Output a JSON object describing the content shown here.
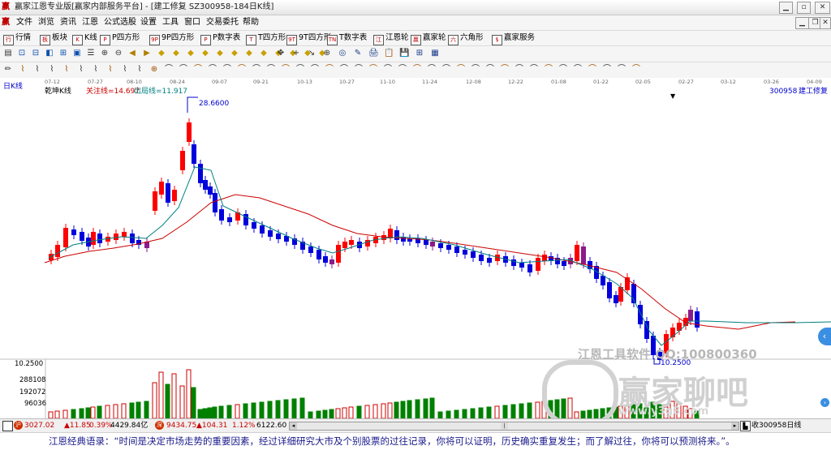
{
  "window": {
    "app_logo": "赢",
    "title": "赢家江恩专业版[赢家内部服务平台] - [建工修复 SZ300958-184日K线]"
  },
  "menu": {
    "logo": "赢",
    "items": [
      "文件",
      "浏览",
      "资讯",
      "江恩",
      "公式选股",
      "设置",
      "工具",
      "窗口",
      "交易委托",
      "帮助"
    ]
  },
  "toolbar1": {
    "items": [
      {
        "icon": "行",
        "label": "行情"
      },
      {
        "icon": "板",
        "label": "板块"
      },
      {
        "icon": "K",
        "label": "K线"
      },
      {
        "icon": "P",
        "label": "P四方形"
      },
      {
        "icon": "9P",
        "label": "9P四方形"
      },
      {
        "icon": "P",
        "label": "P数字表"
      },
      {
        "icon": "T",
        "label": "T四方形"
      },
      {
        "icon": "9T",
        "label": "9T四方形"
      },
      {
        "icon": "TN",
        "label": "T数字表"
      },
      {
        "icon": "江",
        "label": "江恩轮"
      },
      {
        "icon": "赢",
        "label": "赢家轮"
      },
      {
        "icon": "六",
        "label": "六角形"
      },
      {
        "icon": "$",
        "label": "赢家服务"
      }
    ]
  },
  "dates": [
    "07-12",
    "07-27",
    "08-10",
    "08-24",
    "09-07",
    "09-21",
    "10-13",
    "10-27",
    "11-10",
    "11-24",
    "12-08",
    "12-22",
    "01-08",
    "01-22",
    "02-05",
    "02-27",
    "03-12",
    "03-26",
    "04-09"
  ],
  "chart": {
    "period_label": "日K线",
    "indicator_name": "乾坤K线",
    "line1_label": "关注线=14.697",
    "line2_label": "出局线=11.917",
    "stock_code": "300958",
    "stock_name": "建工修复",
    "high_label": "28.6600",
    "low_label": "10.2500",
    "vol_ticks": [
      "10.2500",
      "288108",
      "192072",
      "96036"
    ],
    "colors": {
      "up": "#ff0000",
      "down": "#0000dd",
      "purple": "#8b1a8b",
      "ma_fast": "#008080",
      "ma_slow": "#cc0000",
      "vol_up": "#cc0000",
      "vol_down": "#008000"
    }
  },
  "watermark": {
    "text1": "江恩工具软件  QQ:100800360",
    "brand": "赢家聊吧",
    "url": "www.y3g8.com"
  },
  "status": {
    "sh_index": "3027.02",
    "sh_change": "▲11.85",
    "sh_pct": "0.39%",
    "sh_amount": "4429.84亿",
    "sz_index": "9434.75",
    "sz_change": "▲104.31",
    "sz_pct": "1.12%",
    "sz_amount": "6122.60",
    "right_text": "收300958日线"
  },
  "quote": {
    "text": "江恩经典语录：“时间是决定市场走势的重要因素，经过详细研究大市及个别股票的过往记录，你将可以证明，历史确实重复发生；而了解过往，你将可以预测将来。”。"
  }
}
